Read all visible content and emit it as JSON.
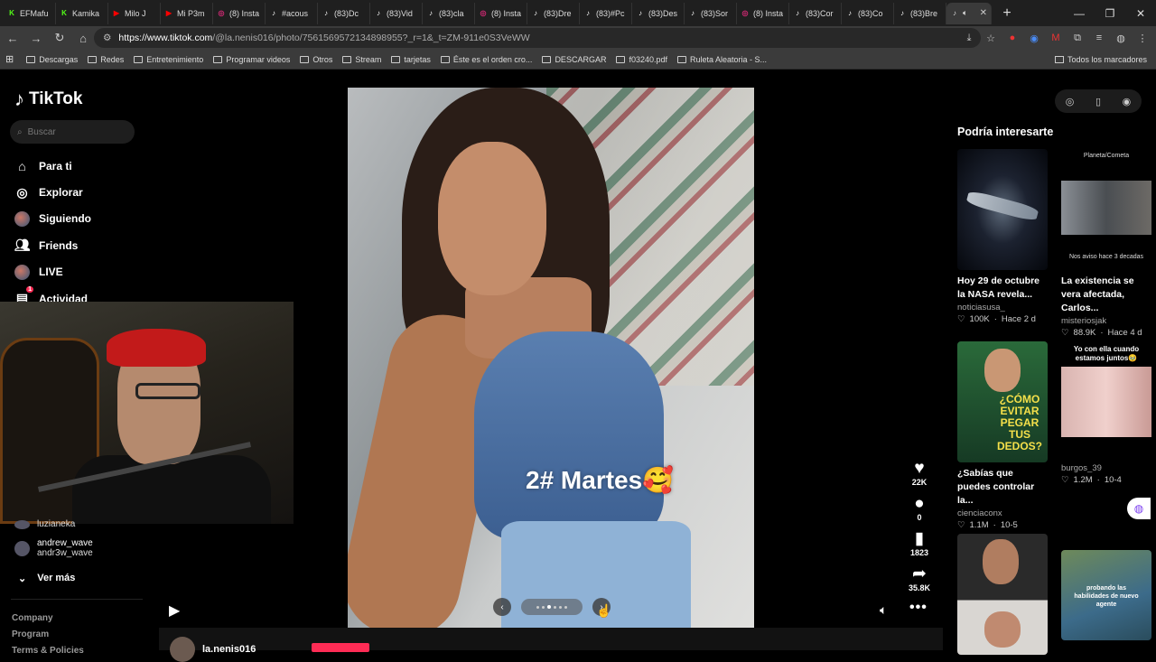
{
  "browser": {
    "tabs": [
      {
        "label": "EFMafu",
        "icon": "K",
        "color": "#53fc18"
      },
      {
        "label": "Kamika",
        "icon": "K",
        "color": "#53fc18"
      },
      {
        "label": "Milo J",
        "icon": "▶",
        "color": "#ff0000"
      },
      {
        "label": "Mi P3m",
        "icon": "▶",
        "color": "#ff0000"
      },
      {
        "label": "(8) Insta",
        "icon": "◎",
        "color": "#d62976"
      },
      {
        "label": "#acous",
        "icon": "♪",
        "color": "#ffffff"
      },
      {
        "label": "(83)Dc",
        "icon": "♪",
        "color": "#ffffff"
      },
      {
        "label": "(83)Vid",
        "icon": "♪",
        "color": "#ffffff"
      },
      {
        "label": "(83)cla",
        "icon": "♪",
        "color": "#ffffff"
      },
      {
        "label": "(8) Insta",
        "icon": "◎",
        "color": "#d62976"
      },
      {
        "label": "(83)Dre",
        "icon": "♪",
        "color": "#ffffff"
      },
      {
        "label": "(83)#Pc",
        "icon": "♪",
        "color": "#ffffff"
      },
      {
        "label": "(83)Des",
        "icon": "♪",
        "color": "#ffffff"
      },
      {
        "label": "(83)Sor",
        "icon": "♪",
        "color": "#ffffff"
      },
      {
        "label": "(8) Insta",
        "icon": "◎",
        "color": "#d62976"
      },
      {
        "label": "(83)Cor",
        "icon": "♪",
        "color": "#ffffff"
      },
      {
        "label": "(83)Co",
        "icon": "♪",
        "color": "#ffffff"
      },
      {
        "label": "(83)Bre",
        "icon": "♪",
        "color": "#ffffff"
      }
    ],
    "url_host": "https://www.tiktok.com",
    "url_path": "/@la.nenis016/photo/7561569572134898955?_r=1&_t=ZM-911e0S3VeWW",
    "bookmarks": [
      "Descargas",
      "Redes",
      "Entretenimiento",
      "Programar videos",
      "Otros",
      "Stream",
      "tarjetas",
      "Éste es el orden cro...",
      "DESCARGAR",
      "f03240.pdf",
      "Ruleta Aleatoria - S..."
    ],
    "all_bookmarks": "Todos los marcadores"
  },
  "sidebar": {
    "logo": "TikTok",
    "search_placeholder": "Buscar",
    "nav": [
      {
        "label": "Para ti",
        "icon": "home-icon"
      },
      {
        "label": "Explorar",
        "icon": "compass-icon"
      },
      {
        "label": "Siguiendo",
        "icon": "avatar-icon"
      },
      {
        "label": "Friends",
        "icon": "friends-icon"
      },
      {
        "label": "LIVE",
        "icon": "live-icon"
      },
      {
        "label": "Actividad",
        "icon": "inbox-icon",
        "badge": "1"
      }
    ],
    "following": [
      {
        "name": "luzianeka",
        "handle": ""
      },
      {
        "name": "andrew_wave",
        "handle": "andr3w_wave"
      }
    ],
    "see_more": "Ver más",
    "footer": [
      "Company",
      "Program",
      "Terms & Policies"
    ]
  },
  "post": {
    "caption": "2# Martes🥰",
    "likes": "22K",
    "comments": "0",
    "saves": "1823",
    "shares": "35.8K",
    "author": "la.nenis016",
    "carousel_dots": 6,
    "carousel_active": 2
  },
  "recommended": {
    "title": "Podría interesarte",
    "cards": [
      {
        "title": "Hoy 29 de octubre la NASA revela...",
        "user": "noticiasusa_",
        "likes": "100K",
        "age": "Hace 2 d",
        "thumb_top": "",
        "thumb_bottom": ""
      },
      {
        "title": "La existencia se vera afectada, Carlos...",
        "user": "misteriosjak",
        "likes": "88.9K",
        "age": "Hace 4 d",
        "thumb_top": "Planeta/Cometa",
        "thumb_bottom": "Nos aviso hace 3 decadas"
      },
      {
        "title": "¿Sabías que puedes controlar la...",
        "user": "cienciaconx",
        "likes": "1.1M",
        "age": "10-5",
        "thumb_top": "¿CÓMO EVITAR PEGAR TUS DEDOS?",
        "thumb_bottom": ""
      },
      {
        "title": "",
        "user": "burgos_39",
        "likes": "1.2M",
        "age": "10-4",
        "thumb_top": "Yo con ella cuando estamos juntos🥹",
        "thumb_bottom": ""
      },
      {
        "title": "",
        "user": "",
        "likes": "",
        "age": "",
        "thumb_top": "",
        "thumb_bottom": ""
      },
      {
        "title": "",
        "user": "",
        "likes": "",
        "age": "",
        "thumb_top": "probando las habilidades de nuevo agente",
        "thumb_bottom": ""
      }
    ]
  }
}
